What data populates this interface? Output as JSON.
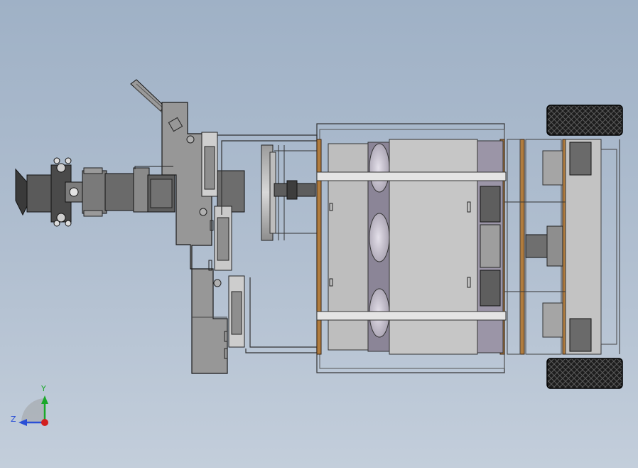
{
  "viewport": {
    "background_top": "#9fb1c6",
    "background_bottom": "#c3cedb"
  },
  "model": {
    "view": "top",
    "colors": {
      "metal_dark": "#6f6f6f",
      "metal_mid": "#8c8c8c",
      "metal_light": "#b4b4b4",
      "panel": "#9a9a9a",
      "edge": "#2a2a2a",
      "wood": "#b07c3e",
      "tire": "#1c1c1c",
      "glass": "#d6d2da"
    }
  },
  "triad": {
    "x_label": "Y",
    "y_label": "Z",
    "y_color": "#1aa82a",
    "z_color": "#2a4fd6",
    "origin_color": "#d21f1f"
  }
}
